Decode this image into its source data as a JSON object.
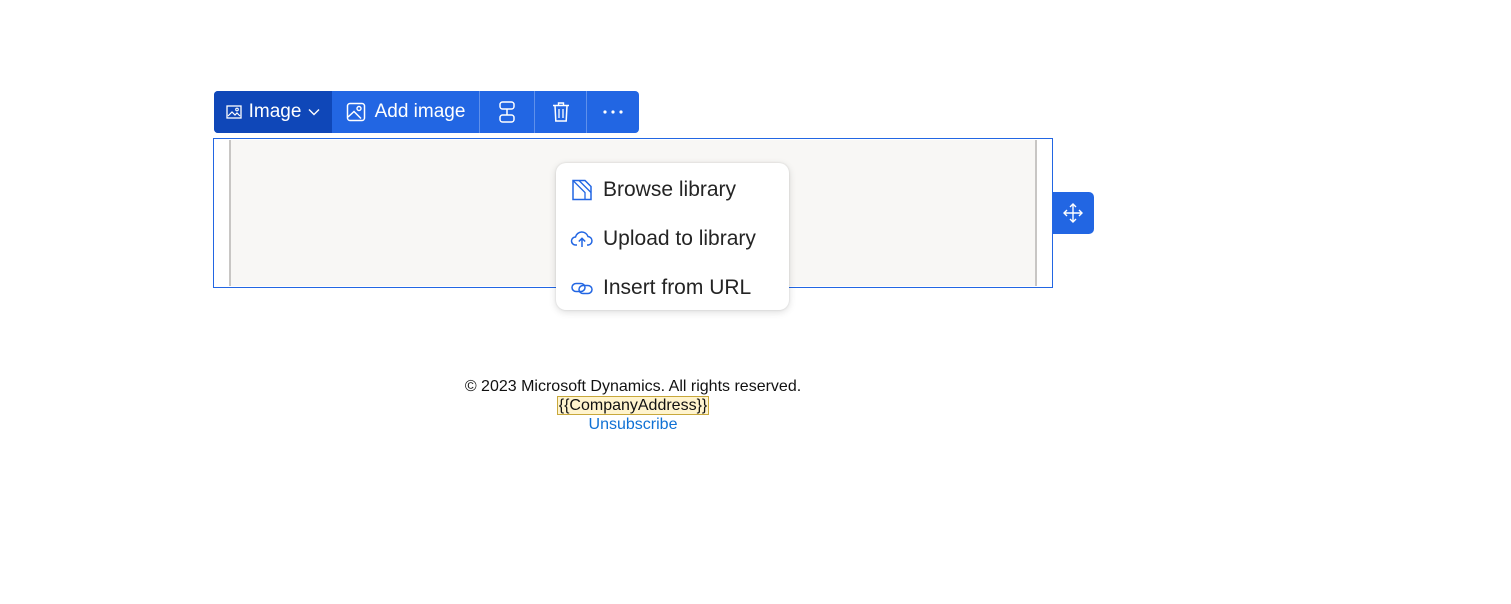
{
  "toolbar": {
    "element_type_label": "Image",
    "add_image_label": "Add image"
  },
  "image_menu": {
    "items": [
      {
        "label": "Browse library",
        "icon": "library-icon"
      },
      {
        "label": "Upload to library",
        "icon": "cloud-upload-icon"
      },
      {
        "label": "Insert from URL",
        "icon": "link-icon"
      }
    ]
  },
  "footer": {
    "copyright": "© 2023 Microsoft Dynamics. All rights reserved.",
    "address_token": "{{CompanyAddress}}",
    "unsubscribe_label": "Unsubscribe"
  },
  "colors": {
    "accent": "#2266e3",
    "accent_dark": "#0f47b8",
    "link": "#1071d4",
    "token_highlight": "#fff4ce"
  }
}
